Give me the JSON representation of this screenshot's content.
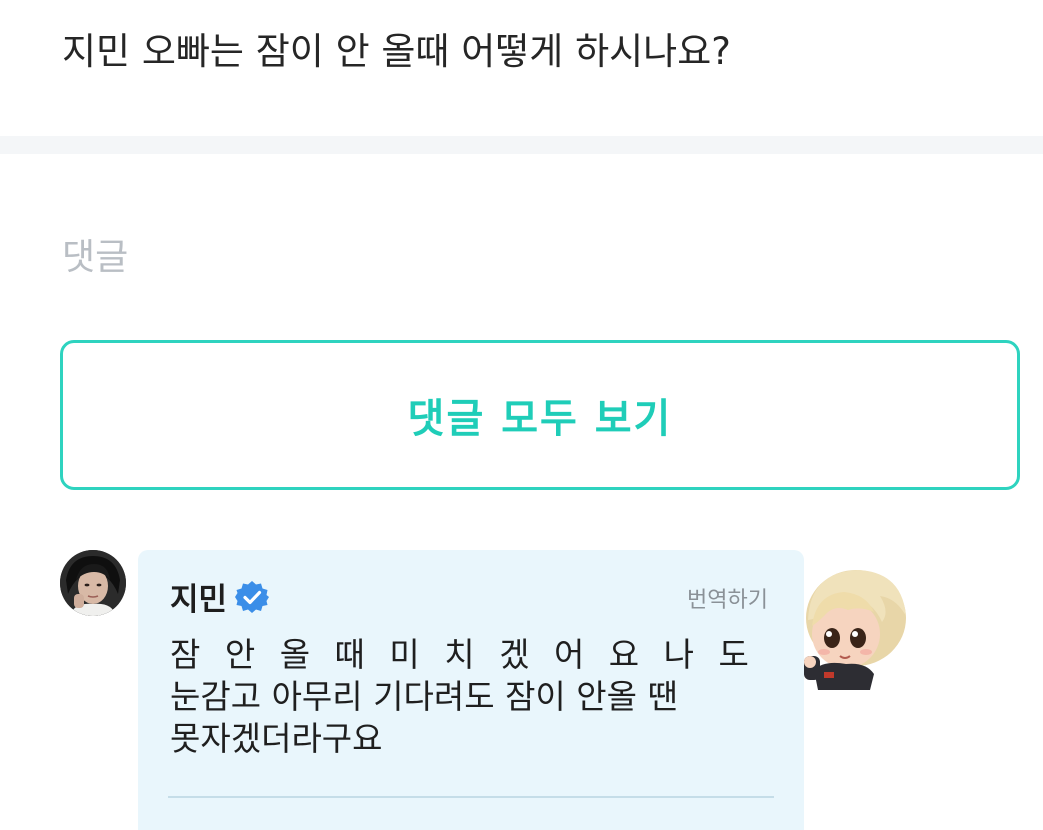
{
  "question": {
    "text": "지민 오빠는 잠이 안 올때 어떻게 하시나요?"
  },
  "comments_section": {
    "label": "댓글",
    "view_all_label": "댓글 모두 보기"
  },
  "reply": {
    "author": "지민",
    "verified": true,
    "translate_label": "번역하기",
    "lines": [
      "잠 안 올 때 미 치 겠 어 요 나 도",
      "눈감고 아무리 기다려도 잠이 안올 땐",
      "못자겠더라구요"
    ],
    "avatar_icon": "profile-photo-avatar",
    "sticker_icon": "chibi-character-sticker"
  },
  "colors": {
    "accent": "#1fcdb8",
    "accent_border": "#2ed3bf",
    "bubble_bg": "#e9f6fc",
    "verified_blue": "#3b8ee8",
    "muted_label": "#b9bec4"
  }
}
